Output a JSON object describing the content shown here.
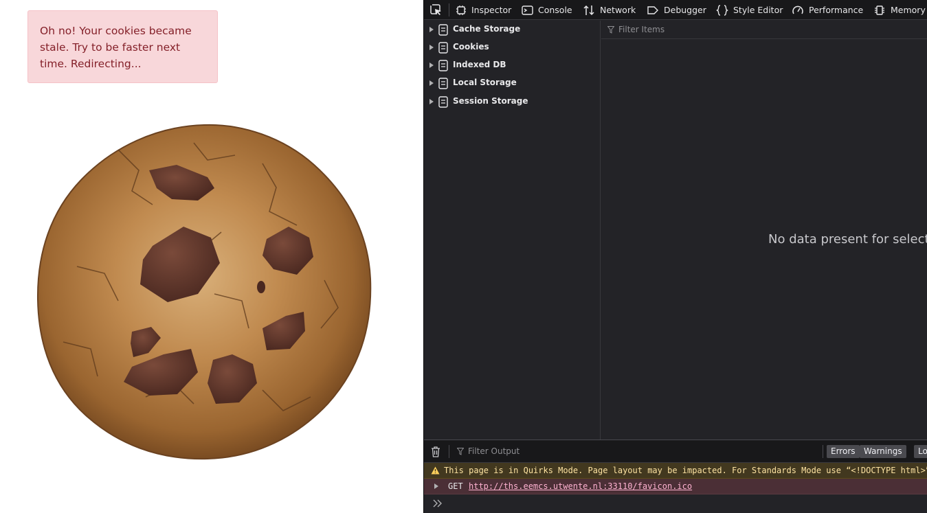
{
  "page": {
    "alert_text": "Oh no! Your cookies became stale. Try to be faster next time. Redirecting..."
  },
  "devtools": {
    "tabs": [
      {
        "label": "Inspector",
        "icon": "inspector-icon"
      },
      {
        "label": "Console",
        "icon": "console-icon"
      },
      {
        "label": "Network",
        "icon": "network-icon"
      },
      {
        "label": "Debugger",
        "icon": "debugger-icon"
      },
      {
        "label": "Style Editor",
        "icon": "style-editor-icon"
      },
      {
        "label": "Performance",
        "icon": "performance-icon"
      },
      {
        "label": "Memory",
        "icon": "memory-icon"
      }
    ],
    "storage_tree": [
      {
        "label": "Cache Storage"
      },
      {
        "label": "Cookies"
      },
      {
        "label": "Indexed DB"
      },
      {
        "label": "Local Storage"
      },
      {
        "label": "Session Storage"
      }
    ],
    "filter_items_placeholder": "Filter Items",
    "empty_message": "No data present for selected host"
  },
  "console": {
    "filter_placeholder": "Filter Output",
    "levels": [
      "Errors",
      "Warnings",
      "Logs"
    ],
    "messages": {
      "warning": "This page is in Quirks Mode. Page layout may be impacted. For Standards Mode use “<!DOCTYPE html>”.",
      "request_method": "GET",
      "request_url": "http://ths.eemcs.utwente.nl:33110/favicon.ico"
    }
  },
  "colors": {
    "alert_bg": "#f8d7da",
    "alert_text": "#842029",
    "devtools_bg": "#232327",
    "warning_bg": "#42381f",
    "error_bg": "#4b2f36"
  }
}
